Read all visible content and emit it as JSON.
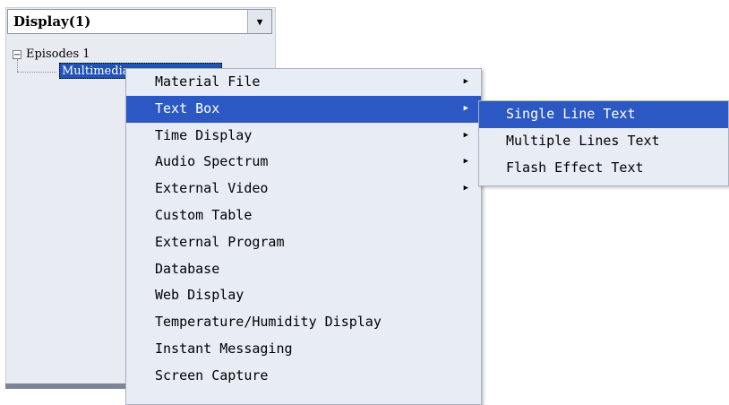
{
  "panel": {
    "dropdown_value": "Display(1)",
    "dropdown_icon": "chevron-down-icon",
    "tree": {
      "root_label": "Episodes 1",
      "root_expander": "−",
      "child_label": "Multimedia"
    }
  },
  "context_menu": {
    "items": [
      {
        "label": "Material File",
        "has_submenu": true
      },
      {
        "label": "Text Box",
        "has_submenu": true,
        "active": true
      },
      {
        "label": "Time Display",
        "has_submenu": true
      },
      {
        "label": "Audio Spectrum",
        "has_submenu": true
      },
      {
        "label": "External Video",
        "has_submenu": true
      },
      {
        "label": "Custom Table",
        "has_submenu": false
      },
      {
        "label": "External Program",
        "has_submenu": false
      },
      {
        "label": "Database",
        "has_submenu": false
      },
      {
        "label": "Web Display",
        "has_submenu": false
      },
      {
        "label": "Temperature/Humidity Display",
        "has_submenu": false
      },
      {
        "label": "Instant Messaging",
        "has_submenu": false
      },
      {
        "label": "Screen Capture",
        "has_submenu": false
      }
    ],
    "arrow_glyph": "▶"
  },
  "submenu": {
    "items": [
      {
        "label": "Single Line Text",
        "active": true
      },
      {
        "label": "Multiple Lines Text"
      },
      {
        "label": "Flash Effect Text"
      }
    ]
  },
  "colors": {
    "highlight": "#2c58c4",
    "menu_bg": "#e8ecf5",
    "panel_bg": "#e8ecf2"
  }
}
